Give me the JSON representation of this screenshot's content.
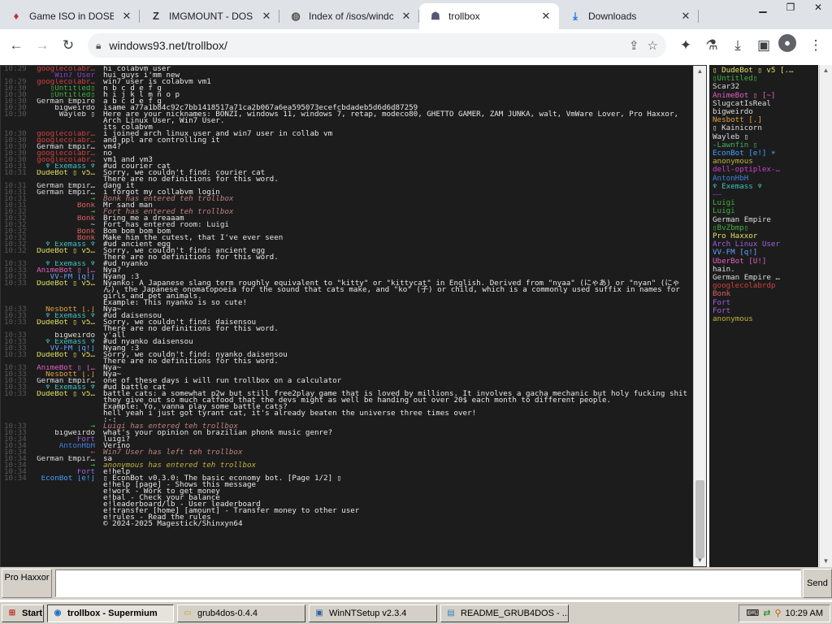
{
  "browser": {
    "tabs": [
      {
        "title": "Game ISO in DOSBo",
        "icon": "dosbox-icon",
        "active": false
      },
      {
        "title": "IMGMOUNT - DOSB",
        "icon": "z-icon",
        "active": false
      },
      {
        "title": "Index of /isos/windc",
        "icon": "globe-icon",
        "active": false
      },
      {
        "title": "trollbox",
        "icon": "trollbox-icon",
        "active": true
      },
      {
        "title": "Downloads",
        "icon": "download-icon",
        "active": false
      }
    ],
    "url": "windows93.net/trollbox/"
  },
  "chat": {
    "messages": [
      {
        "time": "10:29",
        "nick": "googlecolabr…",
        "nc": "#d04040",
        "text": "hi colabvm user"
      },
      {
        "time": "",
        "nick": "Win7 User",
        "nc": "#8040d0",
        "text": "hui guys i'mm new"
      },
      {
        "time": "10:29",
        "nick": "googlecolabr…",
        "nc": "#d04040",
        "text": "win7 user is colabvm vm1"
      },
      {
        "time": "10:30",
        "nick": "▯Untitled▯",
        "nc": "#40b040",
        "text": "n b c d e f g"
      },
      {
        "time": "10:30",
        "nick": "▯Untitled▯",
        "nc": "#40b040",
        "text": "h i j k l m n o p"
      },
      {
        "time": "10:30",
        "nick": "German Empire",
        "nc": "#dddddd",
        "text": "a b c d e f g"
      },
      {
        "time": "10:30",
        "nick": "bigweirdo",
        "nc": "#dddddd",
        "text": "isame a77a1b84c92c7bb1418517a71ca2b067a6ea595073ecefcbdadeb5d6d6d87259"
      },
      {
        "time": "10:30",
        "nick": "Wayleb ▯",
        "nc": "#dddddd",
        "text": "Here are your nicknames: BONZI, windows 11, windows 7, retap, modeco80, GHETTO GAMER, ZAM JUNKA, walt, VmWare Lover, Pro Haxxor, Arch Linux User, Win7 User."
      },
      {
        "time": "",
        "nick": "",
        "nc": "#dddddd",
        "text": "its colabvm"
      },
      {
        "time": "10:30",
        "nick": "googlecolabr…",
        "nc": "#d04040",
        "text": "i joined arch linux user and win7 user in collab vm"
      },
      {
        "time": "10:30",
        "nick": "googlecolabr…",
        "nc": "#d04040",
        "text": "and ppl are controlling it"
      },
      {
        "time": "10:30",
        "nick": "German Empir…",
        "nc": "#dddddd",
        "text": "vm4?"
      },
      {
        "time": "10:30",
        "nick": "googlecolabr…",
        "nc": "#d04040",
        "text": "no"
      },
      {
        "time": "10:30",
        "nick": "googlecolabr…",
        "nc": "#d04040",
        "text": "vm1 and vm3"
      },
      {
        "time": "10:31",
        "nick": "♆ Exemass ♆",
        "nc": "#40c0c0",
        "text": "#ud courier cat"
      },
      {
        "time": "10:31",
        "nick": "DudeBot ▯ v5…",
        "nc": "#e0e060",
        "text": "Sorry, we couldn't find: courier cat\nThere are no definitions for this word."
      },
      {
        "time": "10:31",
        "nick": "German Empir…",
        "nc": "#dddddd",
        "text": "dang it"
      },
      {
        "time": "10:31",
        "nick": "German Empir…",
        "nc": "#dddddd",
        "text": "i forgot my collabvm login"
      },
      {
        "time": "10:31",
        "nick": "→",
        "nc": "#40c040",
        "text": "Bonk has entered teh trollbox",
        "sys": true,
        "tc": "#c08080"
      },
      {
        "time": "10:31",
        "nick": "Bonk",
        "nc": "#e06060",
        "text": "Mr sand man"
      },
      {
        "time": "10:32",
        "nick": "→",
        "nc": "#40c040",
        "text": "Fort has entered teh trollbox",
        "sys": true,
        "tc": "#c08080"
      },
      {
        "time": "10:32",
        "nick": "Bonk",
        "nc": "#e06060",
        "text": "Bring me a dreaaam"
      },
      {
        "time": "10:32",
        "nick": "~",
        "nc": "#dddddd",
        "text": "Fort has entered room: Luigi",
        "tc": "#e0e0e0"
      },
      {
        "time": "10:32",
        "nick": "Bonk",
        "nc": "#e06060",
        "text": "Bom bom bom bom"
      },
      {
        "time": "10:32",
        "nick": "Bonk",
        "nc": "#e06060",
        "text": "Make him the cutest, that I've ever seen"
      },
      {
        "time": "10:32",
        "nick": "♆ Exemass ♆",
        "nc": "#40c0c0",
        "text": "#ud ancient egg"
      },
      {
        "time": "10:32",
        "nick": "DudeBot ▯ v5…",
        "nc": "#e0e060",
        "text": "Sorry, we couldn't find: ancient egg\nThere are no definitions for this word."
      },
      {
        "time": "10:33",
        "nick": "♆ Exemass ♆",
        "nc": "#40c0c0",
        "text": "#ud nyanko"
      },
      {
        "time": "10:33",
        "nick": "AnimeBot ▯ […",
        "nc": "#e060c0",
        "text": "Nya?"
      },
      {
        "time": "10:33",
        "nick": "VV-FM [q!]",
        "nc": "#60a0ff",
        "text": "Nyang :3"
      },
      {
        "time": "10:33",
        "nick": "DudeBot ▯ v5…",
        "nc": "#e0e060",
        "text": "Nyanko: A Japanese slang term roughly equivalent to \"kitty\" or \"kittycat\" in English. Derived from \"nyaa\" (にゃあ) or \"nyan\" (にゃん), the Japanese onomatopoeia for the sound that cats make, and \"ko\" (子) or child, which is a commonly used suffix in names for girls and pet animals.\n\nExample: This nyanko is so cute!"
      },
      {
        "time": "10:33",
        "nick": "Nesbott [.]",
        "nc": "#e0a040",
        "text": "Nya~"
      },
      {
        "time": "10:33",
        "nick": "♆ Exemass ♆",
        "nc": "#40c0c0",
        "text": "#ud daisensou"
      },
      {
        "time": "10:33",
        "nick": "DudeBot ▯ v5…",
        "nc": "#e0e060",
        "text": "Sorry, we couldn't find: daisensou\nThere are no definitions for this word."
      },
      {
        "time": "10:33",
        "nick": "bigweirdo",
        "nc": "#dddddd",
        "text": "y'all"
      },
      {
        "time": "10:33",
        "nick": "♆ Exemass ♆",
        "nc": "#40c0c0",
        "text": "#ud nyanko daisensou"
      },
      {
        "time": "10:33",
        "nick": "VV-FM [q!]",
        "nc": "#60a0ff",
        "text": "Nyang :3"
      },
      {
        "time": "10:33",
        "nick": "DudeBot ▯ v5…",
        "nc": "#e0e060",
        "text": "Sorry, we couldn't find: nyanko daisensou\nThere are no definitions for this word."
      },
      {
        "time": "10:33",
        "nick": "AnimeBot ▯ […",
        "nc": "#e060c0",
        "text": "Nya~"
      },
      {
        "time": "10:33",
        "nick": "Nesbott [.]",
        "nc": "#e0a040",
        "text": "Nya~"
      },
      {
        "time": "10:33",
        "nick": "German Empir…",
        "nc": "#dddddd",
        "text": "one of these days i will run trollbox on a calculator"
      },
      {
        "time": "10:33",
        "nick": "♆ Exemass ♆",
        "nc": "#40c0c0",
        "text": "#ud battle cat"
      },
      {
        "time": "10:33",
        "nick": "DudeBot ▯ v5…",
        "nc": "#e0e060",
        "text": "battle cats: a somewhat p2w but still free2play game that is loved by millions. It involves a gacha mechanic but holy fucking shit they give out so much catfood that the devs might as well be handing out over 20$ each month to different people.\n\nExample: Yo, vanna play some battle cats?\nhell yeah i just got tyrant cat, it's already beaten the universe three times over!\n:-:"
      },
      {
        "time": "10:33",
        "nick": "→",
        "nc": "#40c040",
        "text": "Luigi has entered teh trollbox",
        "sys": true,
        "tc": "#c08080"
      },
      {
        "time": "10:33",
        "nick": "bigweirdo",
        "nc": "#dddddd",
        "text": "what's your opinion on brazilian phonk music genre?"
      },
      {
        "time": "10:34",
        "nick": "Fort",
        "nc": "#a060e0",
        "text": "luigi?"
      },
      {
        "time": "10:34",
        "nick": "AntonHbH",
        "nc": "#4080e0",
        "text": "Verino"
      },
      {
        "time": "10:34",
        "nick": "←",
        "nc": "#e04040",
        "text": "Win7 User has left teh trollbox",
        "sys": true,
        "tc": "#c08080"
      },
      {
        "time": "10:34",
        "nick": "German Empir…",
        "nc": "#dddddd",
        "text": "sa"
      },
      {
        "time": "10:34",
        "nick": "→",
        "nc": "#40c040",
        "text": "anonymous has entered teh trollbox",
        "sys": true,
        "tc": "#c0b040"
      },
      {
        "time": "10:34",
        "nick": "Fort",
        "nc": "#a060e0",
        "text": "e!help"
      },
      {
        "time": "10:34",
        "nick": "EconBot [e!]",
        "nc": "#40a0ff",
        "text": "▯ EconBot v0.3.0: The basic economy bot. [Page 1/2] ▯\n\ne!help [page] - Shows this message\ne!work - Work to get money\ne!bal - Check your balance\ne!leaderboard/lb - User leaderboard\ne!transfer [home] [amount] - Transfer money to other user\ne!rules - Read the rules\n\n© 2024-2025 Magestick/Shinxyn64"
      }
    ]
  },
  "users": [
    {
      "name": "▯ DudeBot ▯ v5 [.…",
      "c": "#e0e060"
    },
    {
      "name": "▯Untitled▯",
      "c": "#40b040"
    },
    {
      "name": "Scar32",
      "c": "#dddddd"
    },
    {
      "name": "AnimeBot ▯ [~]",
      "c": "#e060c0"
    },
    {
      "name": "SlugcatIsReal",
      "c": "#dddddd"
    },
    {
      "name": "bigweirdo",
      "c": "#dddddd"
    },
    {
      "name": "Nesbott [.]",
      "c": "#e0a040"
    },
    {
      "name": "▯ Kainicorn",
      "c": "#dddddd"
    },
    {
      "name": "Wayleb ▯",
      "c": "#dddddd"
    },
    {
      "name": "-Lawnfin ▯",
      "c": "#40b060"
    },
    {
      "name": "EconBot [e!] ☀",
      "c": "#40a0ff"
    },
    {
      "name": "anonymous",
      "c": "#c0b040"
    },
    {
      "name": "dell-optiplex-…",
      "c": "#d040d0"
    },
    {
      "name": "AntonHbH",
      "c": "#4080e0"
    },
    {
      "name": "♆ Exemass ♆",
      "c": "#40c0c0"
    },
    {
      "name": "——",
      "c": "#8040d0"
    },
    {
      "name": "Luigi",
      "c": "#40b040"
    },
    {
      "name": "Luigi",
      "c": "#40b040"
    },
    {
      "name": "German Empire",
      "c": "#dddddd"
    },
    {
      "name": "▯BvZbmp▯",
      "c": "#40b040"
    },
    {
      "name": "Pro Haxxor",
      "c": "#e0e060"
    },
    {
      "name": "Arch Linux User",
      "c": "#a060e0"
    },
    {
      "name": "VV-FM [q!]",
      "c": "#60a0ff"
    },
    {
      "name": "UberBot [U!]",
      "c": "#e060c0"
    },
    {
      "name": "hain.",
      "c": "#dddddd"
    },
    {
      "name": "German Empire …",
      "c": "#dddddd"
    },
    {
      "name": "googlecolabrdp",
      "c": "#d04040"
    },
    {
      "name": "Bonk",
      "c": "#e06060"
    },
    {
      "name": "Fort",
      "c": "#a060e0"
    },
    {
      "name": "Fort",
      "c": "#a060e0"
    },
    {
      "name": "anonymous",
      "c": "#c0b040"
    }
  ],
  "input": {
    "nick_label": "Pro Haxxor",
    "value": "",
    "send_label": "Send"
  },
  "taskbar": {
    "start_label": "Start",
    "items": [
      {
        "label": "trollbox - Supermium",
        "icon": "browser-icon",
        "pressed": true,
        "w": 156
      },
      {
        "label": "grub4dos-0.4.4",
        "icon": "folder-icon",
        "pressed": false,
        "w": 158
      },
      {
        "label": "WinNTSetup v2.3.4",
        "icon": "setup-icon",
        "pressed": false,
        "w": 158
      },
      {
        "label": "README_GRUB4DOS - ...",
        "icon": "notepad-icon",
        "pressed": false,
        "w": 158
      }
    ],
    "clock": "10:29 AM"
  }
}
